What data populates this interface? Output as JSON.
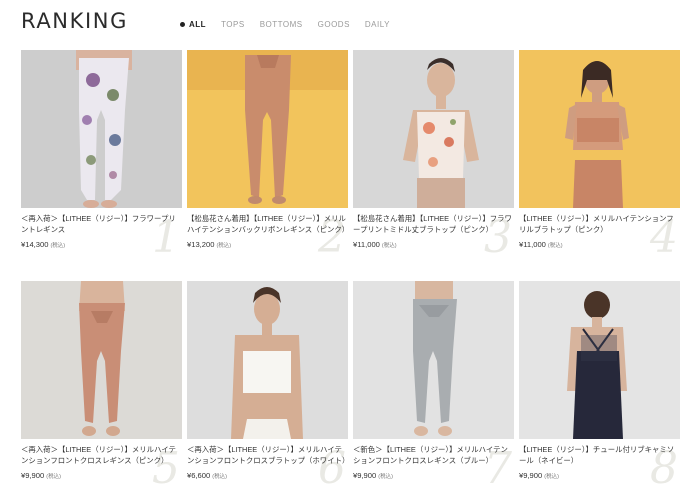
{
  "header": {
    "title": "RANKING"
  },
  "tabs": [
    {
      "label": "ALL",
      "active": true
    },
    {
      "label": "TOPS",
      "active": false
    },
    {
      "label": "BOTTOMS",
      "active": false
    },
    {
      "label": "GOODS",
      "active": false
    },
    {
      "label": "DAILY",
      "active": false
    }
  ],
  "products": [
    {
      "rank": "1",
      "name": "＜再入荷＞【LITHEE（リジー）】フラワープリントレギンス",
      "price": "¥14,300",
      "tax": "(税込)",
      "photo_bg": "#cfcfcf",
      "photo_desc": "model-leggings-floral"
    },
    {
      "rank": "2",
      "name": "【松島花さん着用】【LITHEE（リジー）】メリルハイテンションバックリボンレギンス（ピンク）",
      "price": "¥13,200",
      "tax": "(税込)",
      "photo_bg": "#f0c35a",
      "photo_desc": "model-back-pink-leggings"
    },
    {
      "rank": "3",
      "name": "【松島花さん着用】【LITHEE（リジー）】フラワープリントミドル丈ブラトップ（ピンク）",
      "price": "¥11,000",
      "tax": "(税込)",
      "photo_bg": "#d8d8d8",
      "photo_desc": "model-floral-bratop"
    },
    {
      "rank": "4",
      "name": "【LITHEE（リジー）】メリルハイテンションフリルブラトップ（ピンク）",
      "price": "¥11,000",
      "tax": "(税込)",
      "photo_bg": "#f1c25c",
      "photo_desc": "model-pink-frill-bratop"
    },
    {
      "rank": "5",
      "name": "＜再入荷＞【LITHEE（リジー）】メリルハイテンションフロントクロスレギンス（ピンク）",
      "price": "¥9,900",
      "tax": "(税込)",
      "photo_bg": "#dcdad6",
      "photo_desc": "model-pink-front-cross-leggings"
    },
    {
      "rank": "6",
      "name": "＜再入荷＞【LITHEE（リジー）】メリルハイテンションフロントクロスブラトップ（ホワイト）",
      "price": "¥6,600",
      "tax": "(税込)",
      "photo_bg": "#dedede",
      "photo_desc": "model-white-bratop"
    },
    {
      "rank": "7",
      "name": "＜新色＞【LITHEE（リジー）】メリルハイテンションフロントクロスレギンス（ブルー）",
      "price": "¥9,900",
      "tax": "(税込)",
      "photo_bg": "#e2e2e2",
      "photo_desc": "model-blue-grey-leggings"
    },
    {
      "rank": "8",
      "name": "【LITHEE（リジー）】チュール付リブキャミソール（ネイビー）",
      "price": "¥9,900",
      "tax": "(税込)",
      "photo_bg": "#e4e4e4",
      "photo_desc": "model-navy-camisole-back"
    }
  ]
}
